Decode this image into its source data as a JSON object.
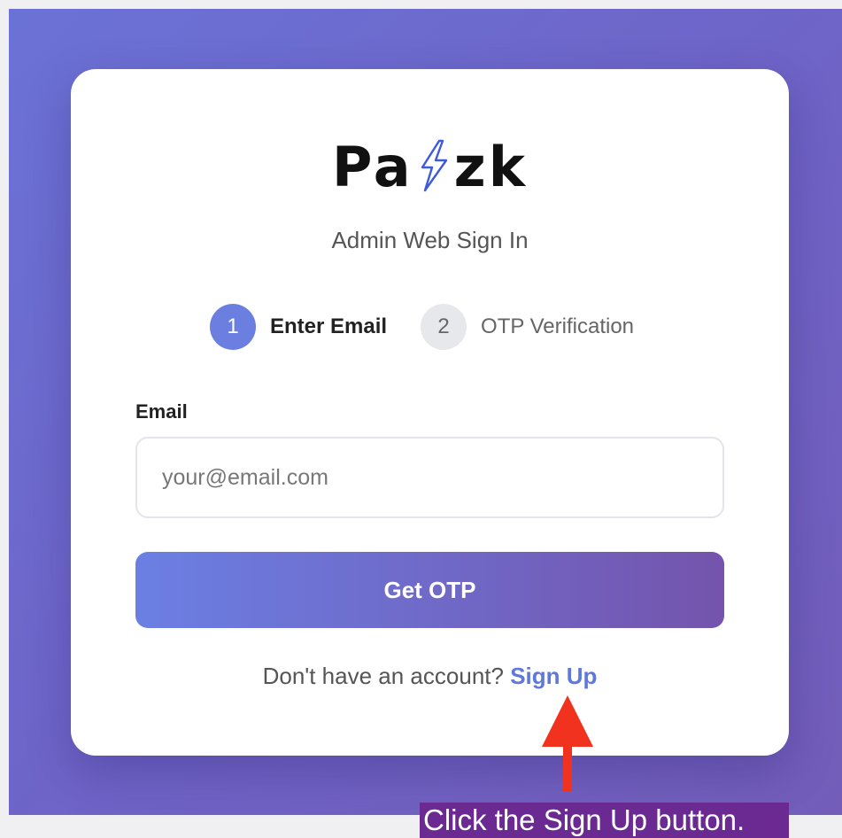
{
  "brand": {
    "logo_left": "Pa",
    "logo_right": "zk",
    "logo_icon": "lightning-bolt-icon",
    "accent_color": "#6a7fe0"
  },
  "page": {
    "subtitle": "Admin Web Sign In"
  },
  "steps": [
    {
      "number": "1",
      "label": "Enter Email",
      "state": "active"
    },
    {
      "number": "2",
      "label": "OTP Verification",
      "state": "inactive"
    }
  ],
  "form": {
    "email_label": "Email",
    "email_placeholder": "your@email.com",
    "email_value": "",
    "submit_label": "Get OTP"
  },
  "signup": {
    "prompt": "Don't have an account?",
    "link_label": "Sign Up"
  },
  "annotation": {
    "instruction": "Click the Sign Up button.",
    "arrow_icon": "red-up-arrow-icon",
    "arrow_color": "#f0321e"
  }
}
